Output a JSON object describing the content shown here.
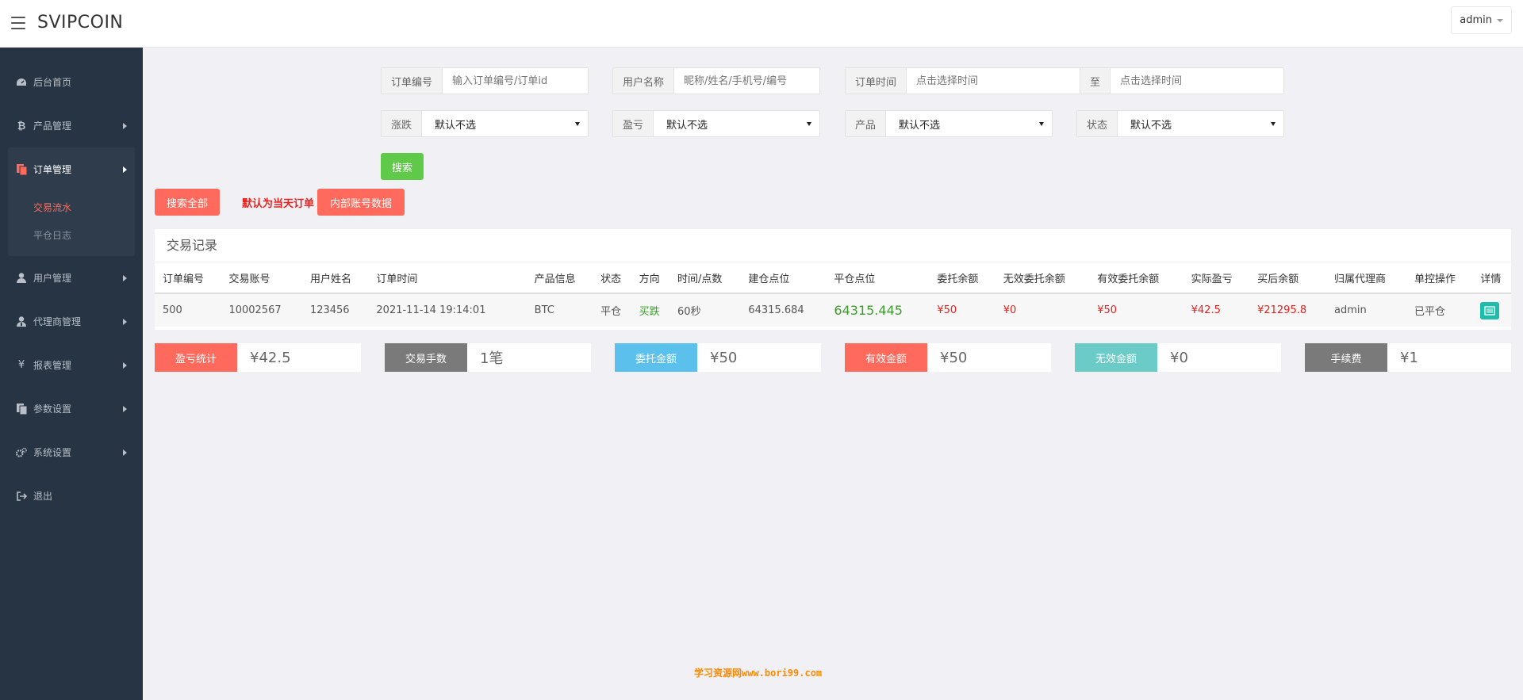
{
  "header": {
    "brand": "SVIPCOIN",
    "user": "admin"
  },
  "sidebar": {
    "items": [
      {
        "label": "后台首页",
        "icon": "dashboard-icon"
      },
      {
        "label": "产品管理",
        "icon": "bitcoin-icon"
      },
      {
        "label": "订单管理",
        "icon": "copy-icon",
        "sub": [
          {
            "label": "交易流水",
            "active": true
          },
          {
            "label": "平仓日志",
            "active": false
          }
        ]
      },
      {
        "label": "用户管理",
        "icon": "user-icon"
      },
      {
        "label": "代理商管理",
        "icon": "user-tie-icon"
      },
      {
        "label": "报表管理",
        "icon": "yen-icon"
      },
      {
        "label": "参数设置",
        "icon": "copy-icon"
      },
      {
        "label": "系统设置",
        "icon": "gears-icon"
      },
      {
        "label": "退出",
        "icon": "sign-out-icon"
      }
    ]
  },
  "filters": {
    "order_no": {
      "label": "订单编号",
      "placeholder": "输入订单编号/订单id"
    },
    "username": {
      "label": "用户名称",
      "placeholder": "昵称/姓名/手机号/编号"
    },
    "order_time": {
      "label": "订单时间",
      "placeholder": "点击选择时间",
      "to": "至",
      "placeholder2": "点击选择时间"
    },
    "rise_fall": {
      "label": "涨跌",
      "value": "默认不选"
    },
    "profit": {
      "label": "盈亏",
      "value": "默认不选"
    },
    "product": {
      "label": "产品",
      "value": "默认不选"
    },
    "status": {
      "label": "状态",
      "value": "默认不选"
    },
    "search_button": "搜索"
  },
  "actions": {
    "search_all": "搜索全部",
    "note": "默认为当天订单",
    "internal": "内部账号数据"
  },
  "records": {
    "title": "交易记录",
    "columns": [
      "订单编号",
      "交易账号",
      "用户姓名",
      "订单时间",
      "产品信息",
      "状态",
      "方向",
      "时间/点数",
      "建仓点位",
      "平仓点位",
      "委托余额",
      "无效委托余额",
      "有效委托余额",
      "实际盈亏",
      "买后余额",
      "归属代理商",
      "单控操作",
      "详情"
    ],
    "rows": [
      {
        "order_no": "500",
        "account": "10002567",
        "name": "123456",
        "time": "2021-11-14 19:14:01",
        "product": "BTC",
        "status": "平仓",
        "direction": "买跌",
        "duration": "60秒",
        "open": "64315.684",
        "close": "64315.445",
        "entrust": "¥50",
        "invalid": "¥0",
        "valid": "¥50",
        "pnl": "¥42.5",
        "balance": "¥21295.8",
        "agent": "admin",
        "control": "已平仓"
      }
    ]
  },
  "stats": [
    {
      "label": "盈亏统计",
      "value": "¥42.5",
      "color": "#ff6a5c"
    },
    {
      "label": "交易手数",
      "value": "1笔",
      "color": "#7a7a7a"
    },
    {
      "label": "委托金额",
      "value": "¥50",
      "color": "#5bc0ec"
    },
    {
      "label": "有效金额",
      "value": "¥50",
      "color": "#ff6a5c"
    },
    {
      "label": "无效金额",
      "value": "¥0",
      "color": "#6bcbc6"
    },
    {
      "label": "手续费",
      "value": "¥1",
      "color": "#7a7a7a"
    }
  ],
  "watermark": "学习资源网www.bori99.com"
}
